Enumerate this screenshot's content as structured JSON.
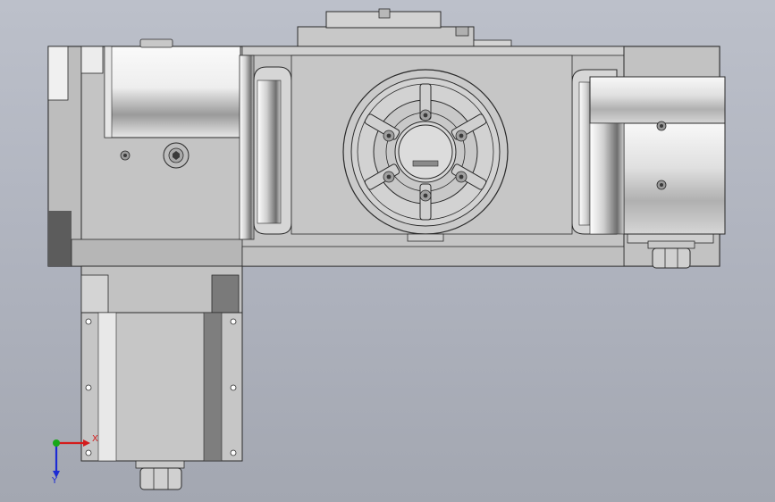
{
  "viewport": {
    "background_top": "#bcc0ca",
    "background_bottom": "#a3a7b1"
  },
  "model": {
    "body_color": "#c6c6c6",
    "edge_color": "#2a2a2a",
    "shadow_color": "#5a5a5a"
  },
  "triad": {
    "x_label": "X",
    "y_label": "Y",
    "x_color": "#d41c1c",
    "y_color": "#1c2bd4",
    "origin_color": "#18a818"
  }
}
